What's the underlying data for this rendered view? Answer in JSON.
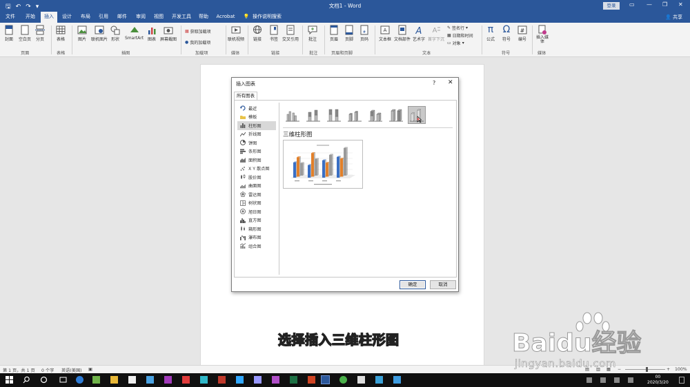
{
  "window": {
    "title": "文档1 - Word",
    "login_label": "登录",
    "share_label": "共享"
  },
  "tabs": [
    {
      "label": "文件"
    },
    {
      "label": "开始"
    },
    {
      "label": "插入"
    },
    {
      "label": "设计"
    },
    {
      "label": "布局"
    },
    {
      "label": "引用"
    },
    {
      "label": "邮件"
    },
    {
      "label": "审阅"
    },
    {
      "label": "视图"
    },
    {
      "label": "开发工具"
    },
    {
      "label": "帮助"
    },
    {
      "label": "Acrobat"
    },
    {
      "label": "操作说明搜索"
    }
  ],
  "active_tab": "插入",
  "ribbon": {
    "cover": "封面",
    "blank": "空白页",
    "break": "分页",
    "table": "表格",
    "picture": "图片",
    "online_picture": "联机图片",
    "shapes": "形状",
    "smartart": "SmartArt",
    "chart": "图表",
    "screenshot": "屏幕截图",
    "get_addins": "获取加载项",
    "my_addins": "我的加载项",
    "online_video": "联机视频",
    "link": "链接",
    "bookmark": "书签",
    "crossref": "交叉引用",
    "comment": "批注",
    "header": "页眉",
    "footer": "页脚",
    "pagenum": "页码",
    "textbox": "文本框",
    "quickparts": "文档部件",
    "wordart": "艺术字",
    "dropcap": "首字下沉",
    "signature": "签名行",
    "datetime": "日期和时间",
    "object": "对象",
    "equation": "公式",
    "symbol": "符号",
    "number": "编号",
    "media": "插入媒体",
    "groups": {
      "pages": "页面",
      "tables": "表格",
      "illustrations": "插图",
      "addins": "加载项",
      "media": "媒体",
      "links": "链接",
      "comments": "批注",
      "header_footer": "页眉和页脚",
      "text": "文本",
      "symbols": "符号",
      "media2": "媒体"
    }
  },
  "dialog": {
    "title": "插入图表",
    "help": "?",
    "tab": "所有图表",
    "categories": [
      {
        "label": "最近"
      },
      {
        "label": "模板"
      },
      {
        "label": "柱形图"
      },
      {
        "label": "折线图"
      },
      {
        "label": "饼图"
      },
      {
        "label": "条形图"
      },
      {
        "label": "面积图"
      },
      {
        "label": "X Y 散点图"
      },
      {
        "label": "股价图"
      },
      {
        "label": "曲面图"
      },
      {
        "label": "雷达图"
      },
      {
        "label": "树状图"
      },
      {
        "label": "旭日图"
      },
      {
        "label": "直方图"
      },
      {
        "label": "箱形图"
      },
      {
        "label": "瀑布图"
      },
      {
        "label": "组合图"
      }
    ],
    "selected_category": "柱形图",
    "preview_title": "三维柱形图",
    "ok_label": "确定",
    "cancel_label": "取消"
  },
  "document": {
    "caption": "选择插入三维柱形图"
  },
  "statusbar": {
    "page": "第 1 页，共 1 页",
    "words": "0 个字",
    "language": "英语(美国)",
    "zoom": "100%"
  },
  "taskbar": {
    "time": "00",
    "date": "2020/3/20"
  },
  "watermark": {
    "brand": "Baidu经验",
    "url": "jingyan.baidu.com"
  },
  "colors": {
    "word_blue": "#2b579a",
    "bar_blue": "#3a6fc4",
    "bar_orange": "#e2802a",
    "bar_gray": "#9a9a9a"
  }
}
